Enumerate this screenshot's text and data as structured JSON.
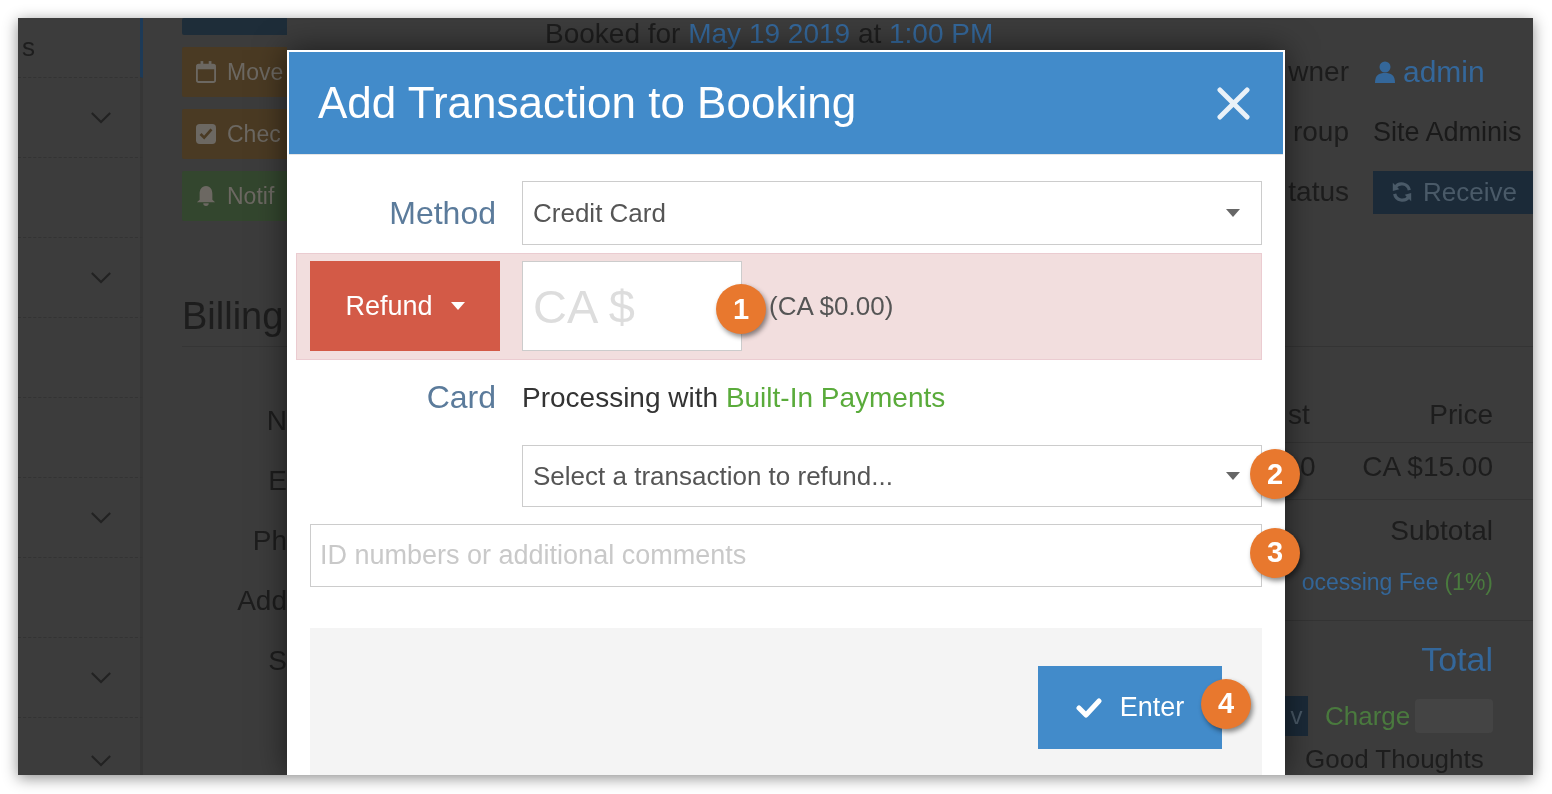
{
  "sidebar": {
    "rows": [
      {
        "label": "s",
        "kind": "plain",
        "selected": true
      },
      {
        "kind": "collapsible",
        "selected": false
      },
      {
        "kind": "plain",
        "selected": false
      },
      {
        "kind": "collapsible",
        "selected": false
      },
      {
        "kind": "plain",
        "selected": false
      },
      {
        "kind": "plain",
        "selected": false
      },
      {
        "kind": "collapsible",
        "selected": false
      },
      {
        "kind": "plain",
        "selected": false
      },
      {
        "kind": "collapsible",
        "selected": false
      },
      {
        "kind": "collapsible",
        "selected": false
      }
    ]
  },
  "actions": [
    {
      "color": "#1e2d39"
    },
    {
      "label": "Move",
      "color": "#4a3a23"
    },
    {
      "label": "Chec",
      "color": "#4a3a23"
    },
    {
      "label": "Notif",
      "color": "#33462e"
    }
  ],
  "billing": {
    "title": "Billing",
    "labels": [
      "N",
      "E",
      "Ph",
      "Add",
      "S"
    ]
  },
  "booking": {
    "segments": [
      {
        "text": "Booked for",
        "kind": "plain"
      },
      {
        "text": "May 19 2019",
        "kind": "link"
      },
      {
        "text": "at",
        "kind": "plain"
      },
      {
        "text": "1:00 PM",
        "kind": "link"
      }
    ]
  },
  "details": [
    {
      "label": "wner",
      "value": "admin",
      "kind": "link"
    },
    {
      "label": "roup",
      "value": "Site Adminis",
      "kind": "text"
    },
    {
      "label": "tatus",
      "value": "Receive",
      "kind": "status"
    }
  ],
  "charges": {
    "columns": [
      "st",
      "Price"
    ],
    "rows": [
      [
        "0",
        "CA $15.00"
      ]
    ],
    "subtotal": "Subtotal",
    "fee": "ocessing Fee",
    "fee_rate": "(1%)",
    "total": "Total",
    "button": "v",
    "charge": "Charge",
    "note": "Good Thoughts"
  },
  "dialog": {
    "title": "Add Transaction to Booking",
    "method": {
      "label": "Method",
      "value": "Credit Card"
    },
    "amount": {
      "type": "Refund",
      "placeholder": "CA $",
      "balance": "(CA $0.00)",
      "highlighted": true,
      "callout": "1"
    },
    "card": {
      "label": "Card",
      "prefix": "Processing with",
      "provider": "Built-In Payments",
      "prompt": "Select a transaction to refund...",
      "callout": "2"
    },
    "comments": {
      "placeholder": "ID numbers or additional comments",
      "callout": "3"
    },
    "submit": {
      "label": "Enter",
      "callout": "4"
    }
  }
}
